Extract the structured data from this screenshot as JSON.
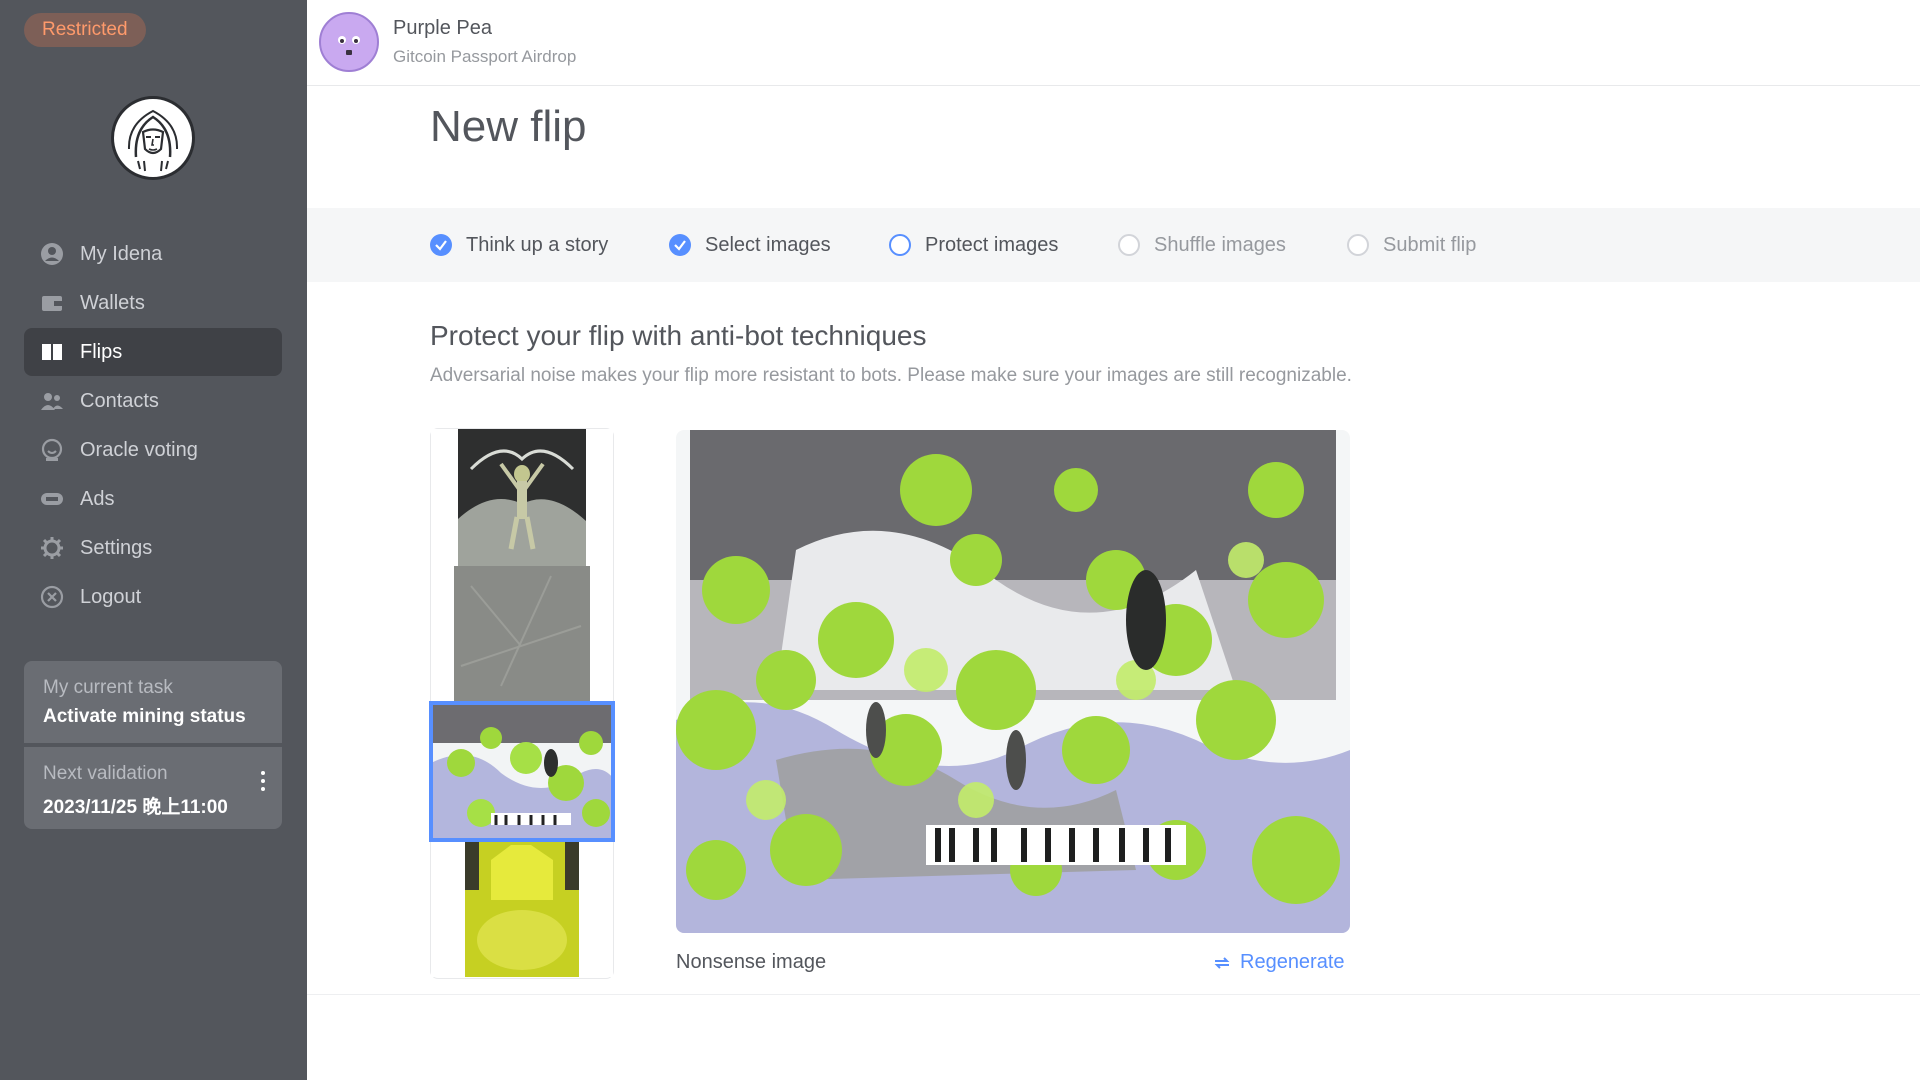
{
  "sidebar": {
    "badge": "Restricted",
    "items": [
      {
        "label": "My Idena",
        "icon": "user-circle-icon"
      },
      {
        "label": "Wallets",
        "icon": "wallet-icon"
      },
      {
        "label": "Flips",
        "icon": "flips-icon",
        "active": true
      },
      {
        "label": "Contacts",
        "icon": "contacts-icon"
      },
      {
        "label": "Oracle voting",
        "icon": "oracle-icon"
      },
      {
        "label": "Ads",
        "icon": "ads-icon"
      },
      {
        "label": "Settings",
        "icon": "gear-icon"
      },
      {
        "label": "Logout",
        "icon": "logout-icon"
      }
    ],
    "task": {
      "label": "My current task",
      "value": "Activate mining status"
    },
    "validation": {
      "label": "Next validation",
      "value": "2023/11/25 晚上11:00"
    }
  },
  "header": {
    "user_name": "Purple Pea",
    "user_sub": "Gitcoin Passport Airdrop"
  },
  "main": {
    "title": "New flip",
    "steps": [
      {
        "label": "Think up a story",
        "state": "done"
      },
      {
        "label": "Select images",
        "state": "done"
      },
      {
        "label": "Protect images",
        "state": "current"
      },
      {
        "label": "Shuffle images",
        "state": "todo"
      },
      {
        "label": "Submit flip",
        "state": "todo"
      }
    ],
    "section_title": "Protect your flip with anti-bot techniques",
    "section_desc": "Adversarial noise makes your flip more resistant to bots. Please make sure your images are still recognizable.",
    "image_caption": "Nonsense image",
    "regenerate_label": "Regenerate",
    "selected_thumb": 3
  },
  "colors": {
    "sidebar_bg": "#53565c",
    "accent": "#578fff",
    "restricted": "#ff9a6b"
  }
}
